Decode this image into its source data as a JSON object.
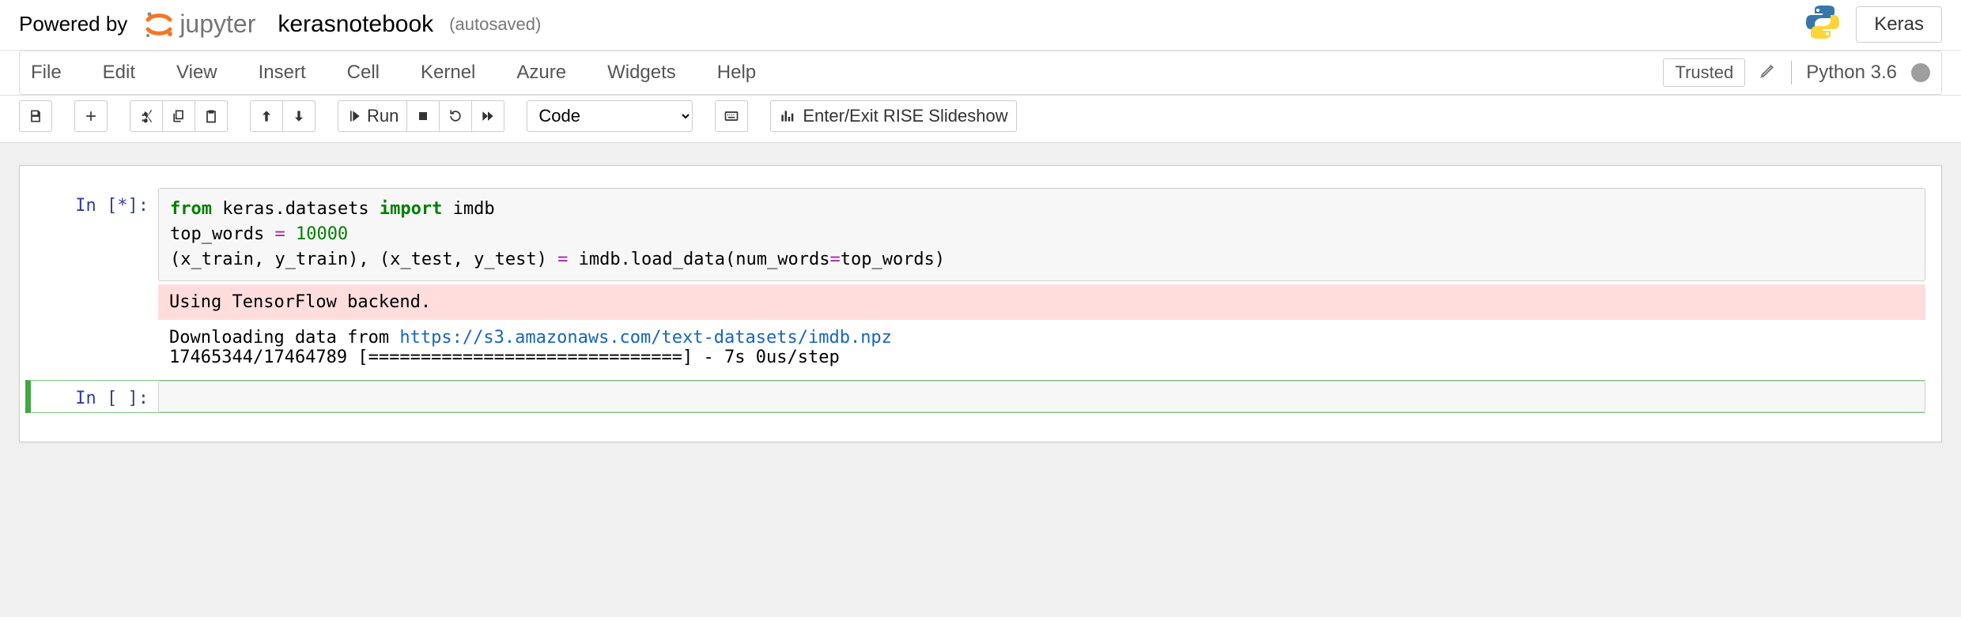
{
  "header": {
    "powered_by": "Powered by",
    "jupyter": "jupyter",
    "notebook_name": "kerasnotebook",
    "save_hint": "(autosaved)",
    "kernel_pill": "Keras"
  },
  "menubar": {
    "items": [
      "File",
      "Edit",
      "View",
      "Insert",
      "Cell",
      "Kernel",
      "Azure",
      "Widgets",
      "Help"
    ],
    "trusted": "Trusted",
    "kernel_name": "Python 3.6"
  },
  "toolbar": {
    "run_label": "Run",
    "cell_type": "Code",
    "rise_label": "Enter/Exit RISE Slideshow"
  },
  "cells": [
    {
      "prompt": "In [*]:",
      "code_tokens": [
        {
          "t": "from ",
          "c": "kw"
        },
        {
          "t": "keras.datasets ",
          "c": ""
        },
        {
          "t": "import ",
          "c": "kw"
        },
        {
          "t": "imdb\n",
          "c": ""
        },
        {
          "t": "top_words ",
          "c": ""
        },
        {
          "t": "= ",
          "c": "op"
        },
        {
          "t": "10000\n",
          "c": "num"
        },
        {
          "t": "(x_train, y_train), (x_test, y_test) ",
          "c": ""
        },
        {
          "t": "= ",
          "c": "op"
        },
        {
          "t": "imdb.load_data(num_words",
          "c": ""
        },
        {
          "t": "=",
          "c": "op"
        },
        {
          "t": "top_words)",
          "c": ""
        }
      ],
      "stderr": "Using TensorFlow backend.",
      "stdout_pre": "Downloading data from ",
      "stdout_link": "https://s3.amazonaws.com/text-datasets/imdb.npz",
      "stdout_post": "17465344/17464789 [==============================] - 7s 0us/step"
    },
    {
      "prompt": "In [ ]:"
    }
  ]
}
